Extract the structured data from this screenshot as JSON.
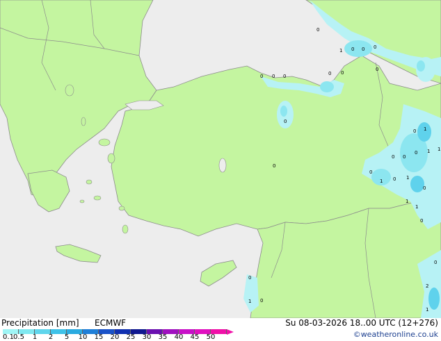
{
  "footer": {
    "title": "Precipitation [mm]",
    "model": "ECMWF",
    "valid_time": "Su 08-03-2026 18..00 UTC (12+276)",
    "credit": "©weatheronline.co.uk"
  },
  "legend": {
    "ticks": [
      "0.1",
      "0.5",
      "1",
      "2",
      "5",
      "10",
      "15",
      "20",
      "25",
      "30",
      "35",
      "40",
      "45",
      "50"
    ],
    "colors": [
      "#9ff5f5",
      "#7fe8f0",
      "#5fd5ec",
      "#3fc2e8",
      "#2aaae0",
      "#1f7fd8",
      "#1a52c8",
      "#1030b0",
      "#101890",
      "#6a10b0",
      "#a010c0",
      "#c810c8",
      "#e010c0",
      "#f010a8"
    ]
  },
  "colors": {
    "land": "#c4f5a0",
    "sea": "#ededed",
    "rain_light": "#b7f2f5",
    "rain_mid": "#8ce6f0",
    "rain_heavy": "#5fd2ec",
    "border": "#8c8c8c"
  },
  "map_labels": [
    "0",
    "0",
    "0",
    "1",
    "0",
    "0",
    "0",
    "0",
    "0",
    "0",
    "0",
    "0",
    "0",
    "1",
    "0",
    "0",
    "1",
    "0",
    "0",
    "1",
    "0",
    "1",
    "0",
    "1",
    "0",
    "1",
    "1",
    "0",
    "0",
    "1",
    "0",
    "2",
    "1",
    "0"
  ]
}
